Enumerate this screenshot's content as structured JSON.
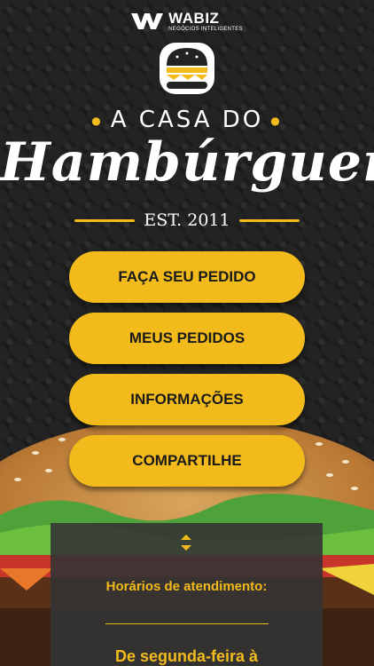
{
  "brand": {
    "platform_name": "WABIZ",
    "platform_tagline": "NEGÓCIOS INTELIGENTES",
    "name_top": "A CASA DO",
    "name_script": "Hambúrguer",
    "established": "EST. 2011"
  },
  "menu": {
    "items": [
      {
        "label": "FAÇA SEU PEDIDO"
      },
      {
        "label": "MEUS PEDIDOS"
      },
      {
        "label": "INFORMAÇÕES"
      },
      {
        "label": "COMPARTILHE"
      }
    ]
  },
  "info_panel": {
    "title": "Horários de atendimento:",
    "text": "De segunda-feira à"
  },
  "colors": {
    "accent": "#f2bb1b",
    "background": "#232323",
    "panel": "#343434"
  },
  "icons": [
    "wabiz-logo-icon",
    "burger-logo-icon",
    "chevron-expand-icon"
  ]
}
